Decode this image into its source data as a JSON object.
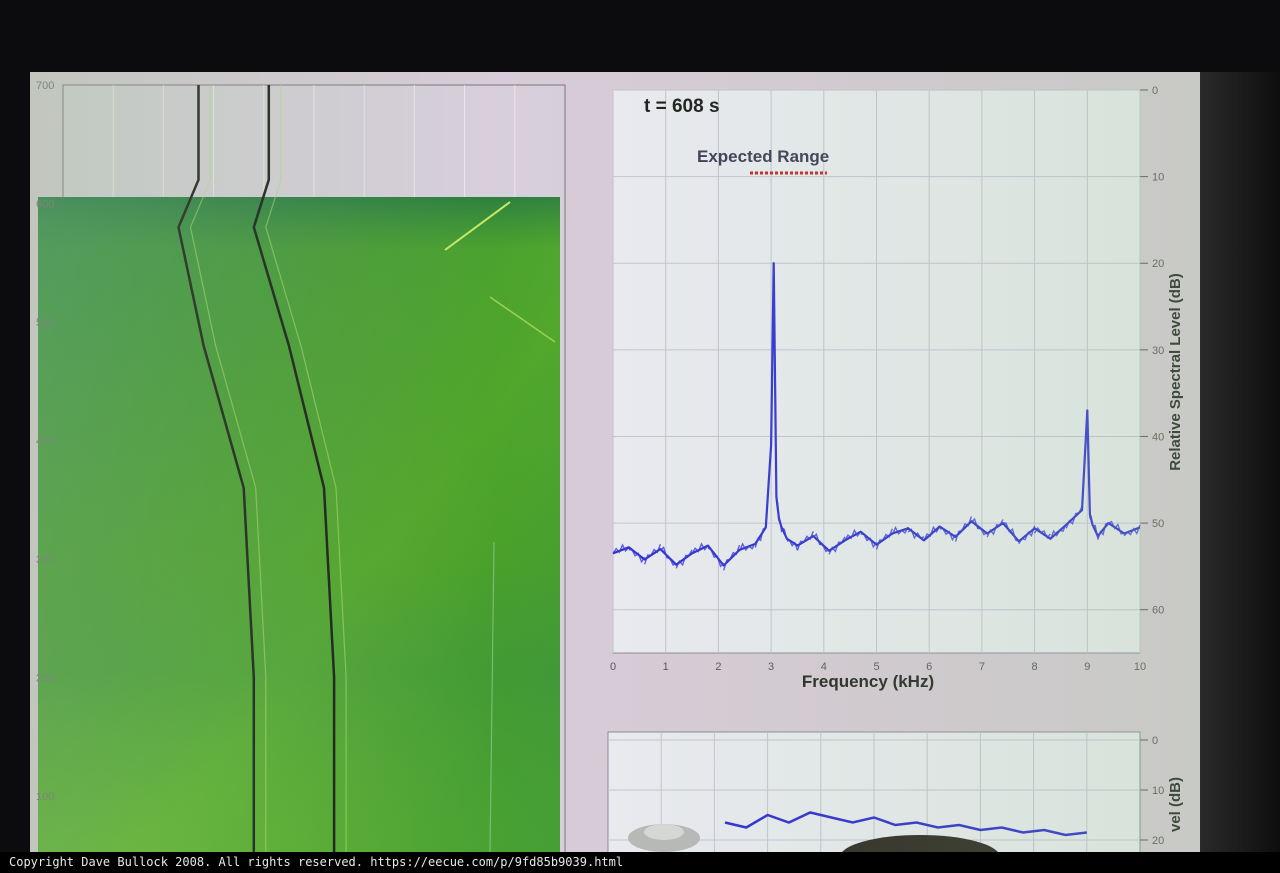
{
  "footer": {
    "copyright": "Copyright Dave Bullock 2008. All rights reserved. https://eecue.com/p/9fd85b9039.html"
  },
  "colors": {
    "spectrum_line": "#2a2ad0",
    "range_marker": "#cc2222",
    "waterfall_green": "#4fa528",
    "plot_background": "#ecebf3"
  },
  "chart_data": [
    {
      "type": "heatmap",
      "title": "",
      "xlabel": "",
      "ylabel": "",
      "y_ticks": [
        "700",
        "600",
        "500",
        "400",
        "300",
        "200",
        "100"
      ],
      "ylim": [
        50,
        700
      ],
      "data_start_time": 608,
      "track_curves": [
        {
          "name": "",
          "points": [
            [
              0.27,
              700
            ],
            [
              0.27,
              620
            ],
            [
              0.23,
              580
            ],
            [
              0.28,
              480
            ],
            [
              0.36,
              360
            ],
            [
              0.38,
              200
            ],
            [
              0.38,
              50
            ]
          ]
        },
        {
          "name": "",
          "points": [
            [
              0.41,
              700
            ],
            [
              0.41,
              620
            ],
            [
              0.38,
              580
            ],
            [
              0.45,
              480
            ],
            [
              0.52,
              360
            ],
            [
              0.54,
              200
            ],
            [
              0.54,
              50
            ]
          ]
        }
      ]
    },
    {
      "type": "line",
      "title": "t = 608 s",
      "annotation": "Expected Range",
      "xlabel": "Frequency (kHz)",
      "ylabel": "Relative Spectral Level (dB)",
      "x_ticks": [
        "0",
        "1",
        "2",
        "3",
        "4",
        "5",
        "6",
        "7",
        "8",
        "9",
        "10"
      ],
      "y_ticks": [
        "0",
        "10",
        "20",
        "30",
        "40",
        "50",
        "60"
      ],
      "xlim": [
        0,
        10
      ],
      "ylim": [
        0,
        65
      ],
      "y_inverted": true,
      "grid": true,
      "series": [
        {
          "name": "",
          "x": [
            0,
            0.3,
            0.6,
            0.9,
            1.2,
            1.5,
            1.8,
            2.1,
            2.4,
            2.7,
            2.9,
            3.0,
            3.05,
            3.1,
            3.15,
            3.2,
            3.3,
            3.5,
            3.8,
            4.1,
            4.4,
            4.7,
            5.0,
            5.3,
            5.6,
            5.9,
            6.2,
            6.5,
            6.8,
            7.1,
            7.4,
            7.7,
            8.0,
            8.3,
            8.6,
            8.9,
            9.0,
            9.05,
            9.1,
            9.2,
            9.4,
            9.7,
            10
          ],
          "y": [
            53.5,
            52.8,
            54.2,
            53.0,
            54.8,
            53.5,
            52.6,
            54.9,
            53.1,
            52.4,
            50.5,
            41.0,
            20.0,
            47.0,
            49.5,
            50.5,
            51.8,
            52.6,
            51.5,
            53.2,
            52.0,
            51.0,
            52.5,
            51.2,
            50.6,
            52.0,
            50.4,
            51.6,
            49.8,
            51.2,
            50.0,
            52.1,
            50.6,
            51.8,
            50.2,
            48.5,
            37.0,
            49.0,
            50.2,
            51.5,
            50.0,
            51.2,
            50.5
          ]
        }
      ]
    },
    {
      "type": "line",
      "title": "",
      "ylabel": "vel (dB)",
      "y_ticks": [
        "0",
        "10",
        "20"
      ],
      "ylim": [
        0,
        20
      ],
      "grid": true,
      "series": [
        {
          "name": "",
          "x": [
            0.22,
            0.26,
            0.3,
            0.34,
            0.38,
            0.42,
            0.46,
            0.5,
            0.54,
            0.58,
            0.62,
            0.66,
            0.7,
            0.74,
            0.78,
            0.82,
            0.86,
            0.9
          ],
          "y": [
            16.5,
            17.5,
            15.0,
            16.5,
            14.5,
            15.5,
            16.5,
            15.5,
            17.0,
            16.5,
            17.5,
            17.0,
            18.0,
            17.5,
            18.5,
            18.0,
            19.0,
            18.5
          ]
        }
      ]
    }
  ]
}
